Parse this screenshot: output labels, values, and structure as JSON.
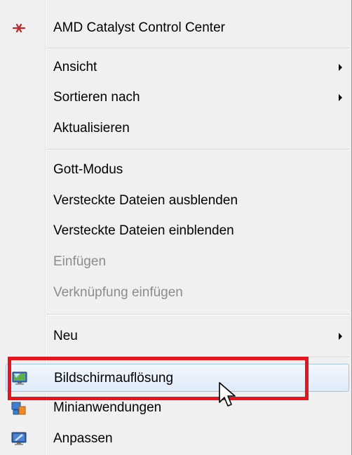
{
  "menu": {
    "items": [
      {
        "label": "AMD Catalyst Control Center",
        "icon": "amd-catalyst-icon"
      },
      {
        "label": "Ansicht",
        "submenu": true
      },
      {
        "label": "Sortieren nach",
        "submenu": true
      },
      {
        "label": "Aktualisieren"
      },
      {
        "label": "Gott-Modus"
      },
      {
        "label": "Versteckte Dateien ausblenden"
      },
      {
        "label": "Versteckte Dateien einblenden"
      },
      {
        "label": "Einfügen",
        "disabled": true
      },
      {
        "label": "Verknüpfung einfügen",
        "disabled": true
      },
      {
        "label": "Neu",
        "submenu": true
      },
      {
        "label": "Bildschirmauflösung",
        "icon": "display-monitor-icon",
        "hovered": true,
        "highlighted": true
      },
      {
        "label": "Minianwendungen",
        "icon": "gadgets-icon"
      },
      {
        "label": "Anpassen",
        "icon": "personalize-icon"
      }
    ]
  },
  "colors": {
    "menu_bg": "#f0f0f0",
    "disabled_text": "#8c8c8c",
    "hover_border": "#a9c3e6",
    "highlight_box": "#e8141d"
  }
}
